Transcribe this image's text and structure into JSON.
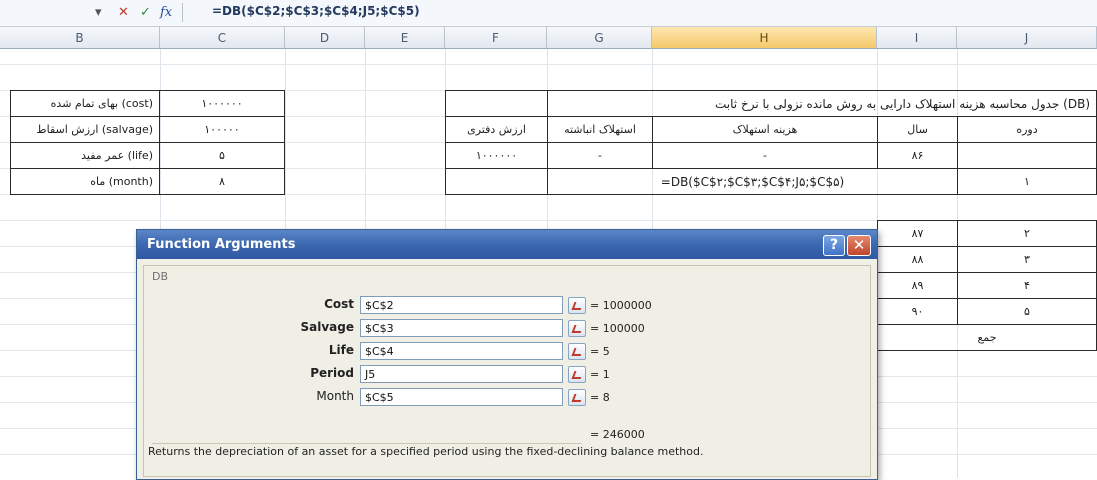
{
  "formula_bar": {
    "dropdown_glyph": "▾",
    "cancel_glyph": "✕",
    "enter_glyph": "✓",
    "fx_label": "fx",
    "formula": "=DB($C$2;$C$3;$C$4;J5;$C$5)"
  },
  "columns": [
    "B",
    "C",
    "D",
    "E",
    "F",
    "G",
    "H",
    "I",
    "J"
  ],
  "left_table": [
    {
      "label": "بهای تمام شده (cost)",
      "value": "۱۰۰۰۰۰۰"
    },
    {
      "label": "ارزش اسقاط (salvage)",
      "value": "۱۰۰۰۰۰"
    },
    {
      "label": "عمر مفید (life)",
      "value": "۵"
    },
    {
      "label": "ماه (month)",
      "value": "۸"
    }
  ],
  "right_table": {
    "title": "جدول محاسبه هزینه استهلاک دارایی به روش مانده نزولی با نرخ ثابت (DB)",
    "headers": [
      "ارزش دفتری",
      "استهلاک انباشته",
      "هزینه استهلاک",
      "سال",
      "دوره"
    ],
    "first_row": {
      "book_value": "۱۰۰۰۰۰۰",
      "accumulated": "-",
      "expense": "-",
      "year": "۸۶"
    },
    "formula_row": {
      "formula": "=DB($C$۲;$C$۳;$C$۴;J۵;$C$۵)",
      "period": "۱"
    },
    "rows": [
      {
        "year": "۸۷",
        "period": "۲"
      },
      {
        "year": "۸۸",
        "period": "۳"
      },
      {
        "year": "۸۹",
        "period": "۴"
      },
      {
        "year": "۹۰",
        "period": "۵"
      }
    ],
    "total_label": "جمع"
  },
  "dialog": {
    "title": "Function Arguments",
    "help_glyph": "?",
    "close_glyph": "✕",
    "function_name": "DB",
    "args": [
      {
        "label": "Cost",
        "input": "$C$2",
        "value": "= 1000000"
      },
      {
        "label": "Salvage",
        "input": "$C$3",
        "value": "= 100000"
      },
      {
        "label": "Life",
        "input": "$C$4",
        "value": "= 5"
      },
      {
        "label": "Period",
        "input": "J5",
        "value": "= 1"
      },
      {
        "label": "Month",
        "input": "$C$5",
        "value": "= 8"
      }
    ],
    "result": "= 246000",
    "description": "Returns the depreciation of an asset for a specified period using the fixed-declining balance method."
  }
}
